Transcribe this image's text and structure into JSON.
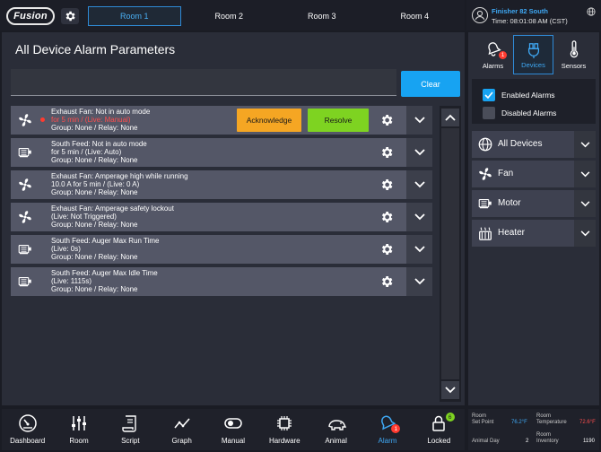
{
  "header": {
    "logo_text": "Fusion",
    "rooms": [
      "Room 1",
      "Room 2",
      "Room 3",
      "Room 4"
    ],
    "active_room": 0,
    "user_name": "Finisher 82 South",
    "time": "Time: 08:01:08 AM (CST)"
  },
  "main": {
    "title": "All Device Alarm Parameters",
    "search_value": "",
    "clear_label": "Clear",
    "acknowledge_label": "Acknowledge",
    "resolve_label": "Resolve",
    "alarms": [
      {
        "device": "fan",
        "line1": "Exhaust Fan: Not in auto mode",
        "line2": "for 5 min / (Live: Manual)",
        "line3": "Group: None / Relay: None",
        "active": true
      },
      {
        "device": "motor",
        "line1": "South Feed: Not in auto mode",
        "line2": "for 5 min / (Live: Auto)",
        "line3": "Group: None / Relay: None",
        "active": false
      },
      {
        "device": "fan",
        "line1": "Exhaust Fan: Amperage high while running",
        "line2": "10.0 A for 5 min / (Live: 0 A)",
        "line3": "Group: None / Relay: None",
        "active": false
      },
      {
        "device": "fan",
        "line1": "Exhaust Fan: Amperage safety lockout",
        "line2": "(Live: Not Triggered)",
        "line3": "Group: None / Relay: None",
        "active": false
      },
      {
        "device": "motor",
        "line1": "South Feed: Auger Max Run Time",
        "line2": "(Live: 0s)",
        "line3": "Group: None / Relay: None",
        "active": false
      },
      {
        "device": "motor",
        "line1": "South Feed: Auger Max Idle Time",
        "line2": "(Live: 1115s)",
        "line3": "Group: None / Relay: None",
        "active": false
      }
    ]
  },
  "side": {
    "tabs": [
      {
        "label": "Alarms",
        "badge": "1"
      },
      {
        "label": "Devices"
      },
      {
        "label": "Sensors"
      }
    ],
    "enabled_label": "Enabled Alarms",
    "disabled_label": "Disabled Alarms",
    "enabled_checked": true,
    "disabled_checked": false,
    "devices": [
      "All Devices",
      "Fan",
      "Motor",
      "Heater"
    ]
  },
  "nav": {
    "items": [
      "Dashboard",
      "Room",
      "Script",
      "Graph",
      "Manual",
      "Hardware",
      "Animal",
      "Alarm",
      "Locked"
    ],
    "alarm_badge": "1",
    "locked_badge": "6"
  },
  "status": {
    "room_label": "Room",
    "setpoint_label": "Set Point",
    "setpoint_value": "76.2°F",
    "temperature_label": "Temperature",
    "temperature_value": "72.6°F",
    "animal_day_label": "Animal Day",
    "animal_day_value": "2",
    "inventory_label": "Inventory",
    "inventory_value": "1190"
  },
  "colors": {
    "accent": "#17a3f2",
    "acknowledge": "#f5a623",
    "resolve": "#7ed321",
    "alarm_red": "#ff4d4d"
  }
}
